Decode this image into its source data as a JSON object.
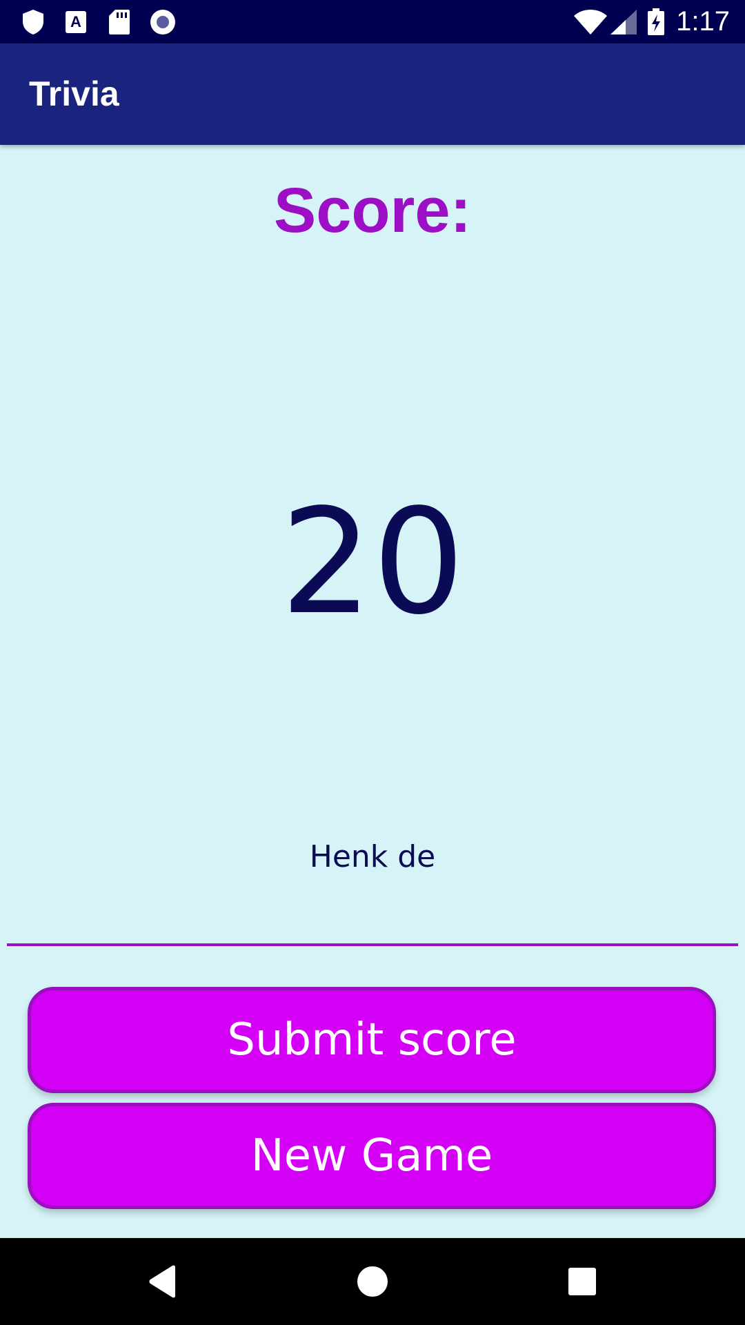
{
  "status_bar": {
    "time": "1:17",
    "left_icons": [
      "shield-icon",
      "font-a-icon",
      "sd-card-icon",
      "record-icon"
    ],
    "right_icons": [
      "wifi-icon",
      "cell-signal-icon",
      "battery-charging-icon"
    ],
    "background": "#000050"
  },
  "app_bar": {
    "title": "Trivia",
    "background": "#1a237e"
  },
  "main": {
    "score_label": "Score:",
    "score_value": "20",
    "name_input": {
      "value": "Henk de",
      "placeholder": ""
    },
    "submit_label": "Submit score",
    "new_game_label": "New Game"
  },
  "nav_bar": {
    "buttons": [
      "back-icon",
      "home-icon",
      "recents-icon"
    ]
  },
  "colors": {
    "background": "#d6f4f7",
    "accent": "#9c0fc4",
    "button_fill": "#d400f5",
    "score_text": "#0a0a55"
  }
}
